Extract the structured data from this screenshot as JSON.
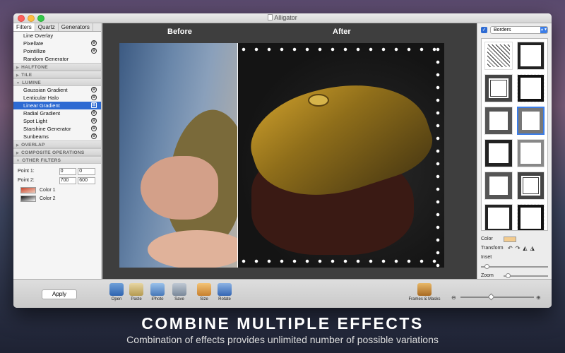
{
  "window": {
    "title": "Alligator"
  },
  "left_panel": {
    "tabs": [
      {
        "label": "Filters",
        "active": true
      },
      {
        "label": "Quartz",
        "active": false
      },
      {
        "label": "Generators",
        "active": false
      }
    ],
    "items_top": [
      {
        "label": "Line Overlay",
        "icon": ""
      },
      {
        "label": "Pixellate",
        "icon": "⊕"
      },
      {
        "label": "Pointillize",
        "icon": "⊕"
      },
      {
        "label": "Random Generator",
        "icon": ""
      }
    ],
    "sections": {
      "halftone": "HALFTONE",
      "tile": "TILE",
      "lumine": "LUMINE",
      "overlap": "OVERLAP",
      "composite": "COMPOSITE OPERATIONS",
      "other": "OTHER FILTERS"
    },
    "lumine_items": [
      {
        "label": "Gaussian Gradient",
        "icon": "⊕"
      },
      {
        "label": "Lenticular Halo",
        "icon": "⊕"
      },
      {
        "label": "Linear Gradient",
        "icon": "⊞",
        "selected": true
      },
      {
        "label": "Radial Gradient",
        "icon": "⊕"
      },
      {
        "label": "Spot Light",
        "icon": "⊞"
      },
      {
        "label": "Starshine Generator",
        "icon": "⊕"
      },
      {
        "label": "Sunbeams",
        "icon": "⊕"
      }
    ],
    "params": {
      "point1_label": "Point 1:",
      "point1_x": "0",
      "point1_y": "0",
      "point2_label": "Point 2:",
      "point2_x": "700",
      "point2_y": "600",
      "color1_label": "Color 1",
      "color2_label": "Color 2"
    }
  },
  "canvas": {
    "before_label": "Before",
    "after_label": "After"
  },
  "right_panel": {
    "borders_checked": true,
    "dropdown_value": "Borders",
    "color_label": "Color",
    "color_value": "#f3cb8e",
    "transform_label": "Transform",
    "inset_label": "Inset",
    "inset_value": 0.05,
    "zoom_label": "Zoom",
    "zoom_value": 0.05
  },
  "toolbar": {
    "apply_label": "Apply",
    "open": "Open",
    "paste": "Paste",
    "iphoto": "iPhoto",
    "save": "Save",
    "size": "Size",
    "rotate": "Rotate",
    "frames": "Frames & Masks"
  },
  "captions": {
    "headline": "COMBINE MULTIPLE EFFECTS",
    "subline": "Combination of effects provides unlimited number of possible variations"
  },
  "colors": {
    "selection": "#2d6ad2",
    "color1": "#c8432a",
    "color2": "#111111"
  }
}
